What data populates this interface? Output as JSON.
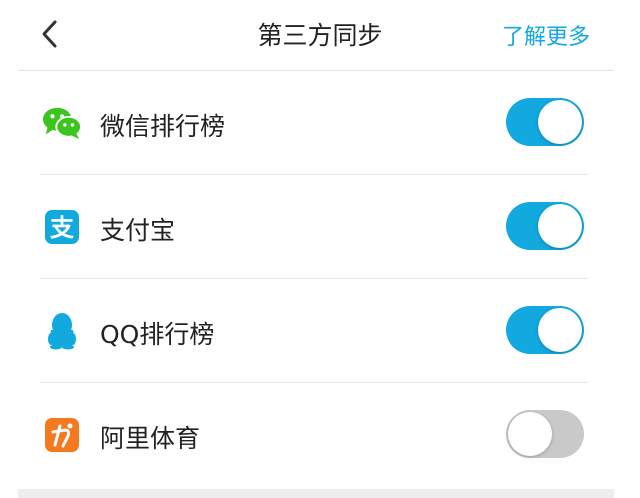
{
  "header": {
    "back_icon": "chevron-left-icon",
    "title": "第三方同步",
    "more_link": "了解更多",
    "accent_color": "#12a9de"
  },
  "items": [
    {
      "label": "微信排行榜",
      "icon": "wechat-icon",
      "icon_color": "#3cc51f",
      "enabled": true
    },
    {
      "label": "支付宝",
      "icon": "alipay-icon",
      "icon_color": "#12a9de",
      "enabled": true
    },
    {
      "label": "QQ排行榜",
      "icon": "qq-penguin-icon",
      "icon_color": "#12a9de",
      "enabled": true
    },
    {
      "label": "阿里体育",
      "icon": "ali-sports-icon",
      "icon_color": "#f4791f",
      "enabled": false
    }
  ],
  "toggle_colors": {
    "on": "#12a9de",
    "off": "#c9c9c9"
  }
}
